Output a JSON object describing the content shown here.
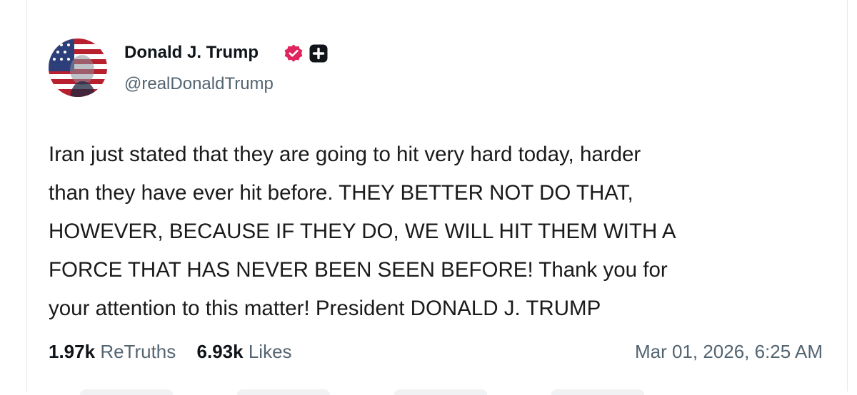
{
  "author": {
    "display_name": "Donald J. Trump",
    "handle": "@realDonaldTrump",
    "avatar_icon": "flag-portrait-avatar",
    "verified_icon": "verified-badge-icon",
    "verified_color": "#e0245e",
    "plus_icon": "plus-badge-icon"
  },
  "post": {
    "lines": [
      "Iran just stated that they are going to hit very hard today, harder",
      "than they have ever hit before. THEY BETTER NOT DO THAT,",
      "HOWEVER, BECAUSE IF THEY DO, WE WILL HIT THEM WITH A",
      "FORCE THAT HAS NEVER BEEN SEEN BEFORE! Thank you for",
      "your attention to this matter! President DONALD J. TRUMP"
    ]
  },
  "stats": {
    "retruths_count": "1.97k",
    "retruths_label": "ReTruths",
    "likes_count": "6.93k",
    "likes_label": "Likes"
  },
  "timestamp": "Mar 01, 2026, 6:25 AM"
}
